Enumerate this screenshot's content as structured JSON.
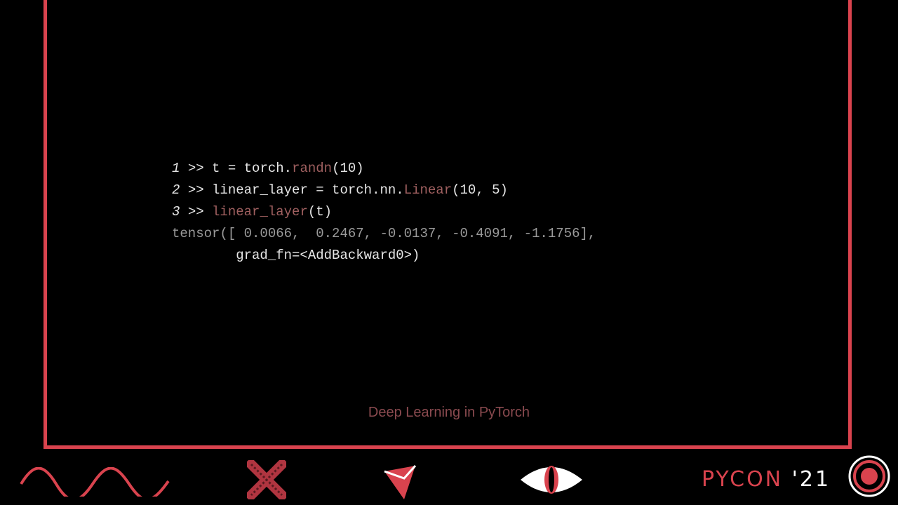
{
  "code": {
    "lines": [
      {
        "num": "1",
        "prompt": ">>",
        "pre": "t = torch.",
        "call": "randn",
        "post": "(10)"
      },
      {
        "num": "2",
        "prompt": ">>",
        "pre": "linear_layer = torch.nn.",
        "call": "Linear",
        "post": "(10, 5)"
      },
      {
        "num": "3",
        "prompt": ">>",
        "pre": "",
        "call": "linear_layer",
        "post": "(t)"
      }
    ],
    "output_line1": "tensor([ 0.0066,  0.2467, -0.0137, -0.4091, -1.1756],",
    "output_line2": "        grad_fn=<AddBackward0>)"
  },
  "footer": {
    "title": "Deep Learning in PyTorch"
  },
  "logo": {
    "name": "PYCON",
    "year": "'21"
  },
  "colors": {
    "accent": "#d9434e",
    "background": "#000000"
  },
  "icons": [
    "wave-icon",
    "cross-icon",
    "triangle-icon",
    "eye-icon",
    "target-icon"
  ]
}
